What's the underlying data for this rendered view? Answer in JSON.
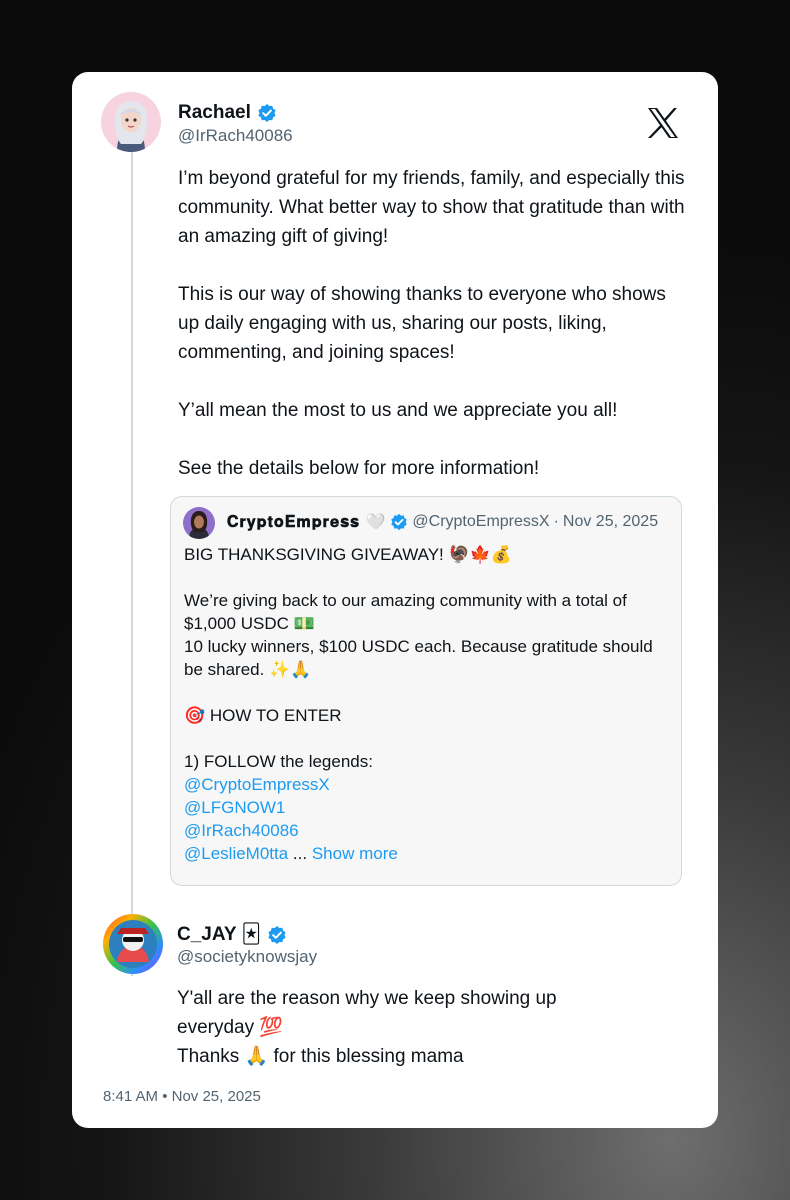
{
  "post": {
    "author_name": "Rachael",
    "author_handle": "@IrRach40086",
    "paragraphs": [
      "I’m beyond grateful for my friends, family, and especially this community. What better way to show that gratitude than with an amazing gift of giving!",
      "This is our way of showing thanks to everyone who shows up daily engaging with us, sharing our posts, liking, commenting, and joining spaces!",
      "Y’all mean the most to us and we appreciate you all!",
      "See the details below for more information!"
    ]
  },
  "quote": {
    "author_name": "𝐂𝐫𝐲𝐩𝐭𝐨𝐄𝐦𝐩𝐫𝐞𝐬𝐬 🤍",
    "author_handle": "@CryptoEmpressX",
    "separator": "·",
    "date": "Nov 25, 2025",
    "headline": "BIG THANKSGIVING GIVEAWAY! 🦃🍁💰",
    "body_1": "We’re giving back to our amazing community with a total of $1,000 USDC 💵",
    "body_2": "10 lucky winners, $100 USDC each. Because gratitude should be shared. ✨🙏",
    "how_to_enter": "🎯 HOW TO ENTER",
    "step_1": "1) FOLLOW the legends:",
    "mentions": [
      "@CryptoEmpressX",
      "@LFGNOW1",
      "@IrRach40086",
      "@LeslieM0tta"
    ],
    "ellipsis": " ...",
    "show_more": "Show more"
  },
  "reply": {
    "author_name": "C_JAY 🃏",
    "author_handle": "@societyknowsjay",
    "line_1": "Y'all are the reason why we keep showing up everyday 💯",
    "line_2": "Thanks 🙏 for this blessing mama"
  },
  "footer": {
    "timestamp": "8:41 AM • Nov 25, 2025"
  },
  "colors": {
    "link": "#1d9bf0",
    "verified": "#1d9bf0",
    "muted_text": "#536471"
  },
  "icons": {
    "verified": "verified-badge-icon",
    "brand": "x-logo-icon"
  }
}
